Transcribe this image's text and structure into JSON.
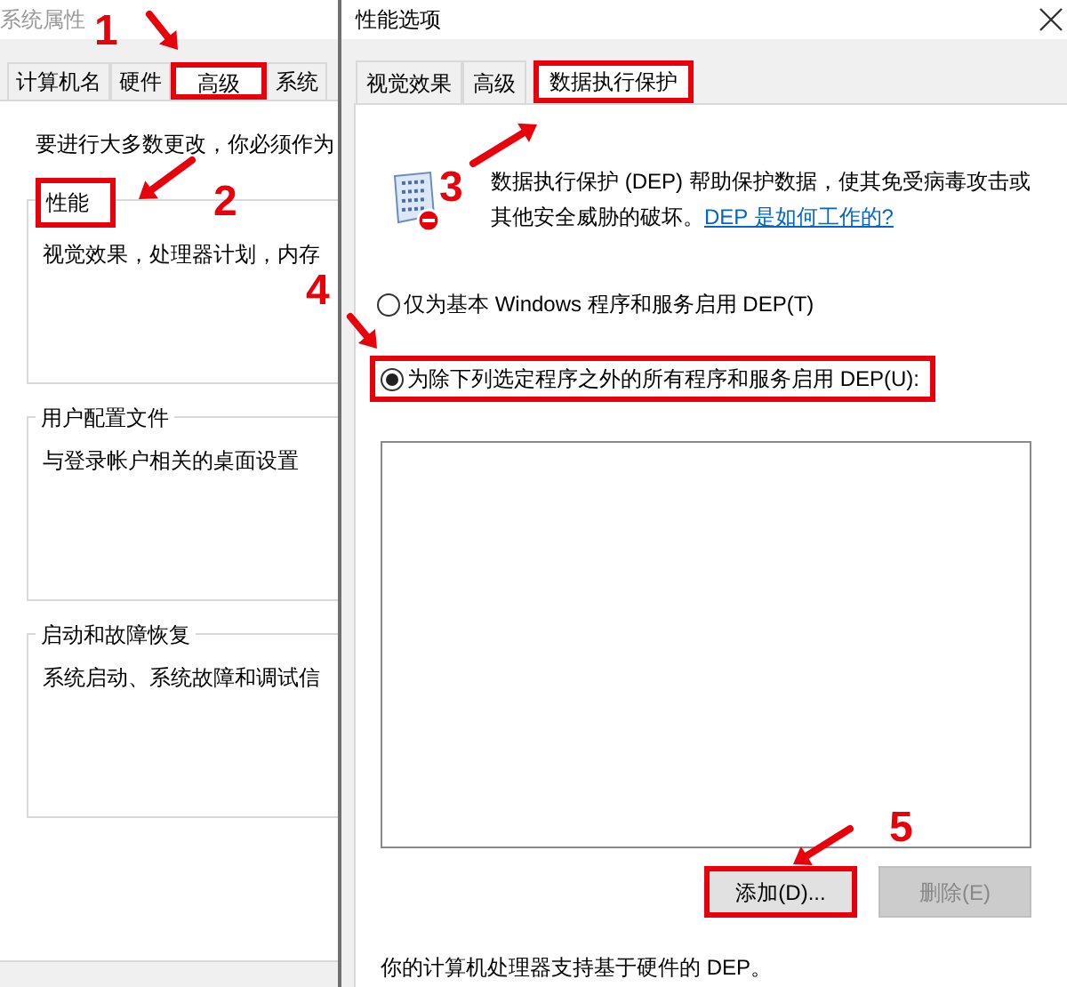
{
  "back_window": {
    "title": "系统属性",
    "tabs": [
      {
        "label": "计算机名",
        "selected": false,
        "highlighted": false
      },
      {
        "label": "硬件",
        "selected": false,
        "highlighted": false
      },
      {
        "label": "高级",
        "selected": true,
        "highlighted": true
      },
      {
        "label": "系统",
        "selected": false,
        "highlighted": false
      }
    ],
    "notice": "要进行大多数更改，你必须作为",
    "groups": [
      {
        "title": "性能",
        "highlighted": true,
        "description": "视觉效果，处理器计划，内存"
      },
      {
        "title": "用户配置文件",
        "highlighted": false,
        "description": "与登录帐户相关的桌面设置"
      },
      {
        "title": "启动和故障恢复",
        "highlighted": false,
        "description": "系统启动、系统故障和调试信"
      }
    ]
  },
  "front_window": {
    "title": "性能选项",
    "tabs": [
      {
        "label": "视觉效果",
        "selected": false,
        "highlighted": false
      },
      {
        "label": "高级",
        "selected": false,
        "highlighted": false
      },
      {
        "label": "数据执行保护",
        "selected": true,
        "highlighted": true
      }
    ],
    "description": "数据执行保护 (DEP) 帮助保护数据，使其免受病毒攻击或其他安全威胁的破坏。",
    "link": "DEP 是如何工作的?",
    "options": [
      {
        "label": "仅为基本 Windows 程序和服务启用 DEP(T)",
        "selected": false,
        "highlighted": false
      },
      {
        "label": "为除下列选定程序之外的所有程序和服务启用 DEP(U):",
        "selected": true,
        "highlighted": true
      }
    ],
    "buttons": [
      {
        "label": "添加(D)...",
        "disabled": false,
        "highlighted": true
      },
      {
        "label": "删除(E)",
        "disabled": true,
        "highlighted": false
      }
    ],
    "footer": "你的计算机处理器支持基于硬件的 DEP。"
  },
  "annotations": [
    {
      "number": "1"
    },
    {
      "number": "2"
    },
    {
      "number": "3"
    },
    {
      "number": "4"
    },
    {
      "number": "5"
    }
  ]
}
